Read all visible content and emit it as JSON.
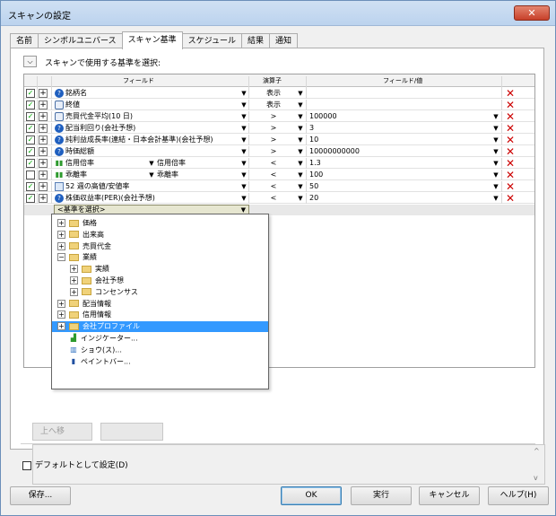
{
  "window": {
    "title": "スキャンの設定",
    "close_label": "✕"
  },
  "tabs": [
    {
      "label": "名前",
      "active": false
    },
    {
      "label": "シンボルユニバース",
      "active": false
    },
    {
      "label": "スキャン基準",
      "active": true
    },
    {
      "label": "スケジュール",
      "active": false
    },
    {
      "label": "結果",
      "active": false
    },
    {
      "label": "通知",
      "active": false
    }
  ],
  "criteria": {
    "prompt": "スキャンで使用する基準を選択:",
    "columns": {
      "field": "フィールド",
      "operator": "演算子",
      "field_value": "フィールド/値"
    },
    "rows": [
      {
        "checked": true,
        "icon": "globe",
        "field": "銘柄名",
        "sub": "",
        "op": "表示",
        "value": ""
      },
      {
        "checked": true,
        "icon": "doc",
        "field": "終値",
        "sub": "",
        "op": "表示",
        "value": ""
      },
      {
        "checked": true,
        "icon": "doc",
        "field": "売買代金平均(10 日)",
        "sub": "",
        "op": ">",
        "value": "100000"
      },
      {
        "checked": true,
        "icon": "globe",
        "field": "配当利回り(会社予想)",
        "sub": "",
        "op": ">",
        "value": "3"
      },
      {
        "checked": true,
        "icon": "globe",
        "field": "純利益成長率(連結・日本会計基準)(会社予想)",
        "sub": "",
        "op": ">",
        "value": "10"
      },
      {
        "checked": true,
        "icon": "globe",
        "field": "時価総額",
        "sub": "",
        "op": ">",
        "value": "10000000000"
      },
      {
        "checked": true,
        "icon": "bars",
        "field": "信用倍率",
        "sub": "信用倍率",
        "op": "<",
        "value": "1.3"
      },
      {
        "checked": false,
        "icon": "bars",
        "field": "乖離率",
        "sub": "乖離率",
        "op": "<",
        "value": "100"
      },
      {
        "checked": true,
        "icon": "cal",
        "field": "52 週の高値/安値率",
        "sub": "",
        "op": "<",
        "value": "50"
      },
      {
        "checked": true,
        "icon": "globe",
        "field": "株価収益率(PER)(会社予想)",
        "sub": "",
        "op": "<",
        "value": "20"
      }
    ],
    "select_placeholder": "<基準を選択>"
  },
  "dropdown_tree": [
    {
      "label": "価格",
      "type": "folder",
      "expander": "+",
      "indent": 0
    },
    {
      "label": "出来高",
      "type": "folder",
      "expander": "+",
      "indent": 0
    },
    {
      "label": "売買代金",
      "type": "folder",
      "expander": "+",
      "indent": 0
    },
    {
      "label": "業績",
      "type": "folder",
      "expander": "−",
      "indent": 0
    },
    {
      "label": "実績",
      "type": "folder",
      "expander": "+",
      "indent": 1
    },
    {
      "label": "会社予想",
      "type": "folder",
      "expander": "+",
      "indent": 1
    },
    {
      "label": "コンセンサス",
      "type": "folder",
      "expander": "+",
      "indent": 1
    },
    {
      "label": "配当情報",
      "type": "folder",
      "expander": "+",
      "indent": 0
    },
    {
      "label": "信用情報",
      "type": "folder",
      "expander": "+",
      "indent": 0
    },
    {
      "label": "会社プロファイル",
      "type": "folder",
      "expander": "+",
      "indent": 0,
      "selected": true
    },
    {
      "label": "インジケーター...",
      "type": "indicator",
      "expander": "",
      "indent": 0
    },
    {
      "label": "ショウ(ス)...",
      "type": "study",
      "expander": "",
      "indent": 0
    },
    {
      "label": "ペイントバー...",
      "type": "paintbar",
      "expander": "",
      "indent": 0
    }
  ],
  "move_up_label": "上へ移",
  "default_label": "デフォルトとして設定(D)",
  "buttons": {
    "save": "保存...",
    "ok": "OK",
    "run": "実行",
    "cancel": "キャンセル",
    "help": "ヘルプ(H)"
  }
}
